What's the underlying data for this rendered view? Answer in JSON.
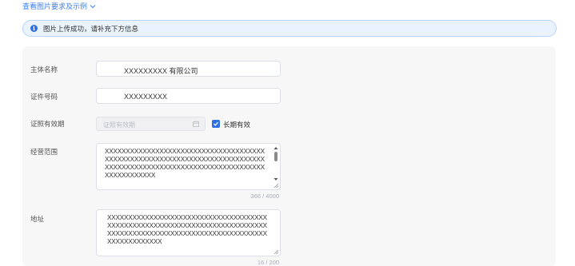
{
  "top_link": {
    "label": "查看图片要求及示例"
  },
  "alert": {
    "message": "图片上传成功，请补充下方信息"
  },
  "form": {
    "subject_name": {
      "label": "主体名称",
      "value": "XXXXXXXXX 有限公司"
    },
    "cert_number": {
      "label": "证件号码",
      "value": "XXXXXXXXX"
    },
    "cert_validity": {
      "label": "证照有效期",
      "placeholder": "证照有效期",
      "long_term_label": "长期有效",
      "long_term_checked": true
    },
    "business_scope": {
      "label": "经营范围",
      "value": "XXXXXXXXXXXXXXXXXXXXXXXXXXXXXXXXXXXXXXXXXXXXXXXXXXXXXXXXXXXXXXXXXXXXXXXXXXXXXXXXXXXXXXXXXXXXXXXXXXXXXXXXXXXXXXXXXXXXXXXXXXXXXX",
      "counter": "366 / 4000"
    },
    "address": {
      "label": "地址",
      "value": "XXXXXXXXXXXXXXXXXXXXXXXXXXXXXXXXXXXXXXXXXXXXXXXXXXXXXXXXXXXXXXXXXXXXXXXXXXXXXXXXXXXXXXXXXXXXXXXXXXXXXXXXXXXXXXXXXXXXXXXXXXXXXXX",
      "counter": "16 / 200"
    }
  },
  "colors": {
    "accent": "#2f6fe4",
    "link": "#3b7ff2",
    "alert_bg": "#eaf3fd",
    "panel_bg": "#f7f7f8"
  }
}
